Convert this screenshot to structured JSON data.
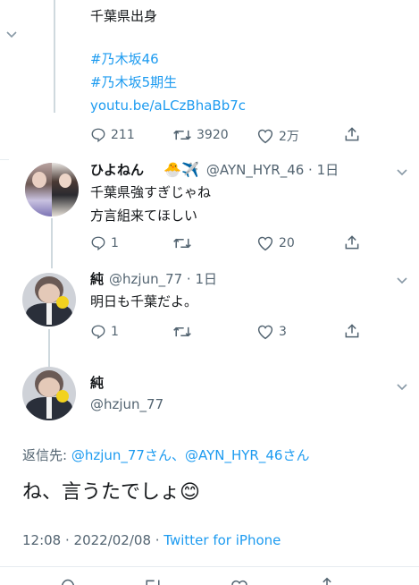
{
  "tweet1": {
    "bio_line": "千葉県出身",
    "hashtag1": "#乃木坂46",
    "hashtag2": "#乃木坂5期生",
    "link": "youtu.be/aLCzBhaBb7c",
    "replies": "211",
    "retweets": "3920",
    "likes": "2万"
  },
  "tweet2": {
    "name": "ひよねん",
    "name_emoji": "🐣✈️",
    "handle_time": "@AYN_HYR_46 · 1日",
    "line1": "千葉県強すぎじゃね",
    "line2": "方言組来てほしい",
    "replies": "1",
    "retweets": "",
    "likes": "20"
  },
  "tweet3": {
    "name": "純",
    "handle_time": "@hzjun_77 · 1日",
    "line1": "明日も千葉だよ。",
    "replies": "1",
    "retweets": "",
    "likes": "3"
  },
  "tweet4": {
    "name": "純",
    "handle": "@hzjun_77",
    "reply_label": "返信先: ",
    "reply_user1": "@hzjun_77",
    "reply_san1": "さん、",
    "reply_user2": "@AYN_HYR_46",
    "reply_san2": "さん",
    "text": "ね、言うたでしょ",
    "emoji": "😊",
    "meta_time": "12:08 · 2022/02/08 · ",
    "meta_source": "Twitter for iPhone"
  },
  "colors": {
    "accent": "#1d9bf0",
    "muted": "#536471"
  }
}
